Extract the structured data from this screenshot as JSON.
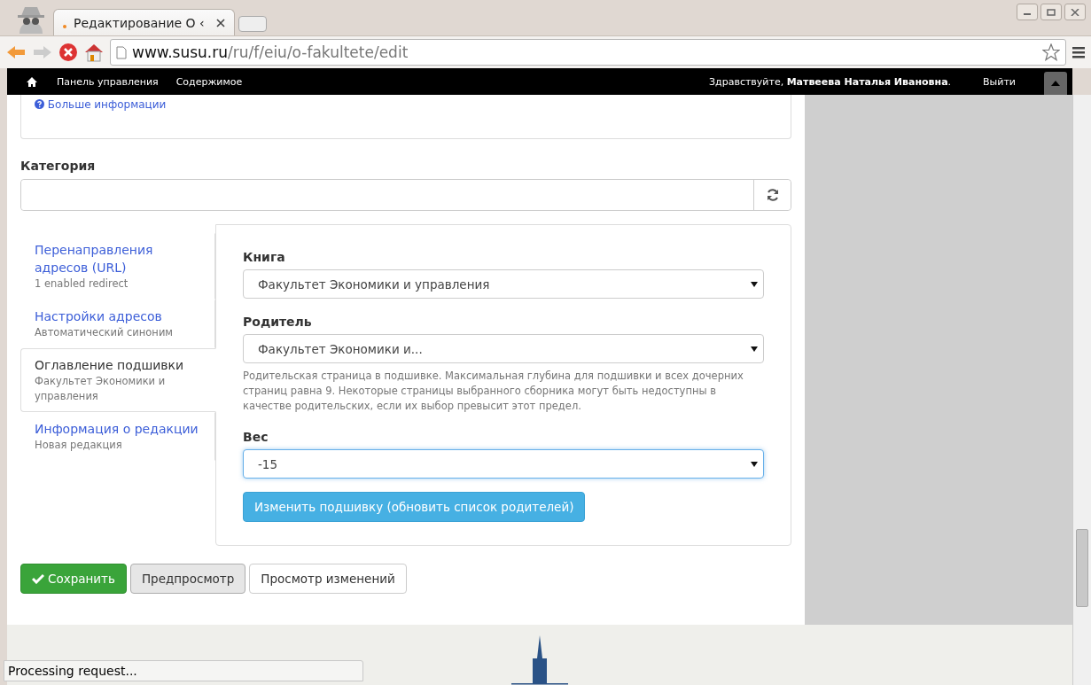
{
  "browser": {
    "tab_title": "Редактирование О ‹",
    "url_host": "www.susu.ru",
    "url_path": "/ru/f/eiu/o-fakultete/edit"
  },
  "admin_bar": {
    "items": [
      "Панель управления",
      "Содержимое"
    ],
    "greeting": "Здравствуйте, ",
    "user": "Матвеева Наталья Ивановна",
    "after_user": ".",
    "logout": "Выйти"
  },
  "more_info_link": "Больше информации",
  "category": {
    "label": "Категория"
  },
  "vertical_tabs": [
    {
      "title": "Перенаправления адресов (URL)",
      "summary": "1 enabled redirect",
      "selected": false
    },
    {
      "title": "Настройки адресов",
      "summary": "Автоматический синоним",
      "selected": false
    },
    {
      "title": "Оглавление подшивки",
      "summary": "Факультет Экономики и управления",
      "selected": true
    },
    {
      "title": "Информация о редакции",
      "summary": "Новая редакция",
      "selected": false
    }
  ],
  "book_fields": [
    {
      "label": "Книга",
      "value": "Факультет Экономики и управления",
      "focused": false
    },
    {
      "label": "Родитель",
      "value": "Факультет Экономики и...",
      "focused": false,
      "description": "Родительская страница в подшивке. Максимальная глубина для подшивки и всех дочерних страниц равна 9. Некоторые страницы выбранного сборника могут быть недоступны в качестве родительских, если их выбор превысит этот предел."
    },
    {
      "label": "Вес",
      "value": "-15",
      "focused": true
    }
  ],
  "update_button": "Изменить подшивку (обновить список родителей)",
  "actions": [
    {
      "label": "Сохранить",
      "kind": "primary"
    },
    {
      "label": "Предпросмотр",
      "kind": "pressed"
    },
    {
      "label": "Просмотр изменений",
      "kind": "default"
    }
  ],
  "status_bubble": "Processing request..."
}
